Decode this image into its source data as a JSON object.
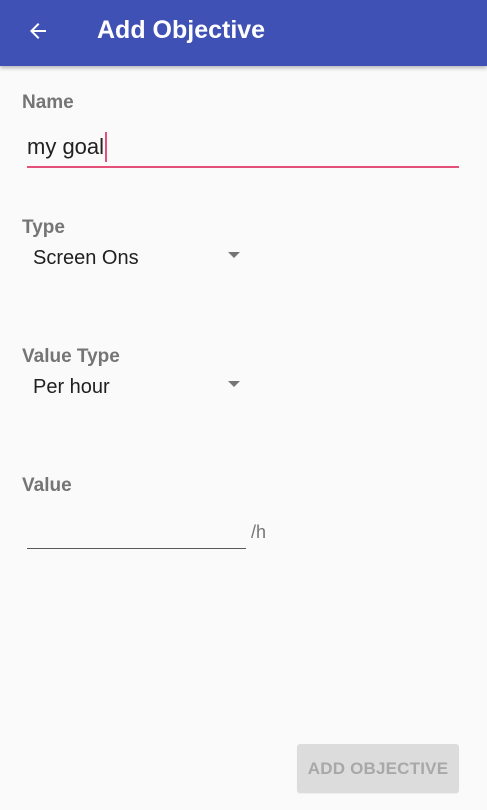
{
  "app_bar": {
    "title": "Add Objective",
    "back_icon": "arrow-back-icon",
    "background": "#3f51b5"
  },
  "form": {
    "name": {
      "label": "Name",
      "value": "my goal"
    },
    "type": {
      "label": "Type",
      "selected": "Screen Ons"
    },
    "value_type": {
      "label": "Value Type",
      "selected": "Per hour"
    },
    "value": {
      "label": "Value",
      "input_value": "",
      "unit": "/h"
    }
  },
  "actions": {
    "add_label": "ADD OBJECTIVE",
    "enabled": false
  },
  "colors": {
    "accent": "#e5507a",
    "primary": "#3f51b5",
    "disabled_button_bg": "#dcdcdc"
  }
}
